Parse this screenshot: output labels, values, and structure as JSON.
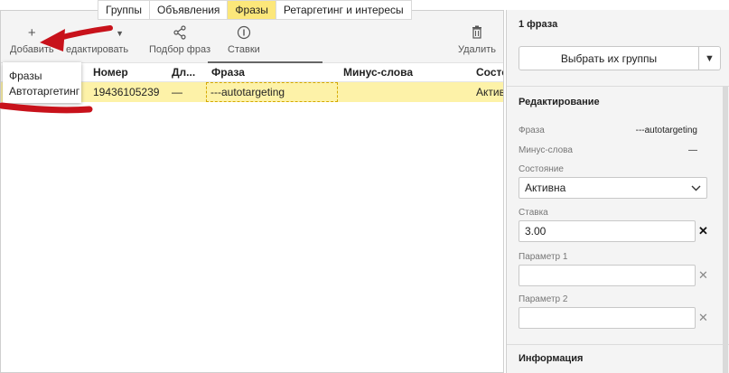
{
  "tabs": [
    {
      "label": "Группы",
      "active": false
    },
    {
      "label": "Объявления",
      "active": false
    },
    {
      "label": "Фразы",
      "active": true
    },
    {
      "label": "Ретаргетинг и интересы",
      "active": false
    }
  ],
  "toolbar": {
    "add": {
      "label": "Добавить",
      "icon": "plus-icon"
    },
    "edit": {
      "label": "едактировать",
      "icon": "chevron-down-icon"
    },
    "select_phrases": {
      "label": "Подбор фраз",
      "icon": "share-nodes-icon"
    },
    "bids": {
      "label": "Ставки",
      "icon": "bid-coin-icon"
    },
    "delete": {
      "label": "Удалить",
      "icon": "trash-icon"
    }
  },
  "add_menu": {
    "items": [
      "Фразы",
      "Автотаргетинг"
    ]
  },
  "table": {
    "columns": [
      "Номер",
      "Дл...",
      "Фраза",
      "Минус-слова",
      "Состо"
    ],
    "rows": [
      {
        "number": "19436105239",
        "length": "—",
        "phrase": "---autotargeting",
        "minus": "",
        "state": "Активн"
      }
    ]
  },
  "panel": {
    "title": "1 фраза",
    "select_groups": "Выбрать их группы",
    "edit_section": "Редактирование",
    "phrase_label": "Фраза",
    "phrase_value": "---autotargeting",
    "minus_label": "Минус-слова",
    "minus_value": "—",
    "state_label": "Состояние",
    "state_value": "Активна",
    "bid_label": "Ставка",
    "bid_value": "3.00",
    "param1_label": "Параметр 1",
    "param1_value": "",
    "param2_label": "Параметр 2",
    "param2_value": "",
    "info_section": "Информация"
  },
  "colors": {
    "active_tab": "#fce77a",
    "selected_row": "#fdf2a8",
    "annotation_arrow": "#c8121b"
  }
}
